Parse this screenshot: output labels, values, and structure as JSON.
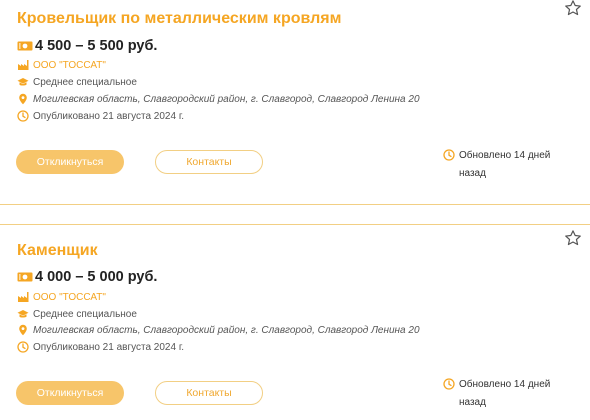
{
  "colors": {
    "accent": "#f5a623",
    "button_fill": "#f7c56a",
    "border": "#f2cf84"
  },
  "vacancies": [
    {
      "title": "Кровельщик по металлическим кровлям",
      "salary": "4 500 – 5 500 руб.",
      "company": "ООО \"ТОССАТ\"",
      "education": "Среднее специальное",
      "address": "Могилевская область, Славгородский район, г. Славгород, Славгород Ленина 20",
      "published": "Опубликовано 21 августа 2024 г.",
      "apply_label": "Откликнуться",
      "contacts_label": "Контакты",
      "updated_line1": "Обновлено 14 дней",
      "updated_line2": "назад",
      "icons": {
        "favorite": "star-outline-icon",
        "salary": "money-icon",
        "company": "factory-icon",
        "education": "graduation-cap-icon",
        "address": "location-pin-icon",
        "published": "clock-icon"
      }
    },
    {
      "title": "Каменщик",
      "salary": "4 000 – 5 000 руб.",
      "company": "ООО \"ТОССАТ\"",
      "education": "Среднее специальное",
      "address": "Могилевская область, Славгородский район, г. Славгород, Славгород Ленина 20",
      "published": "Опубликовано 21 августа 2024 г.",
      "apply_label": "Откликнуться",
      "contacts_label": "Контакты",
      "updated_line1": "Обновлено 14 дней",
      "updated_line2": "назад",
      "icons": {
        "favorite": "star-outline-icon",
        "salary": "money-icon",
        "company": "factory-icon",
        "education": "graduation-cap-icon",
        "address": "location-pin-icon",
        "published": "clock-icon"
      }
    }
  ]
}
